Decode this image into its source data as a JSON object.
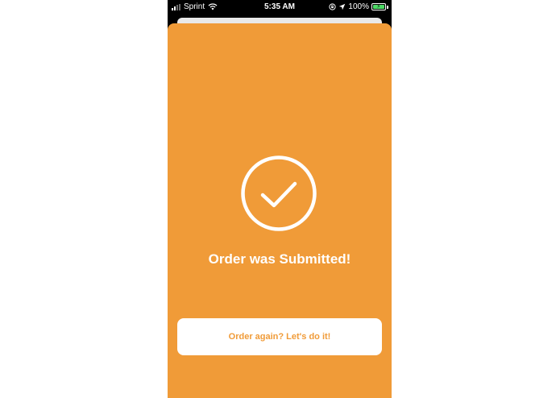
{
  "status_bar": {
    "carrier": "Sprint",
    "time": "5:35 AM",
    "battery_percent": "100%"
  },
  "icons": {
    "signal": "cellular-signal-icon",
    "wifi": "wifi-icon",
    "lock": "orientation-lock-icon",
    "location": "location-arrow-icon",
    "battery": "battery-charging-icon",
    "success": "checkmark-circle-icon"
  },
  "colors": {
    "accent": "#f09b38",
    "on_accent": "#ffffff",
    "battery_fill": "#4cd964"
  },
  "confirmation": {
    "title": "Order was Submitted!",
    "button_label": "Order again? Let's do it!"
  }
}
